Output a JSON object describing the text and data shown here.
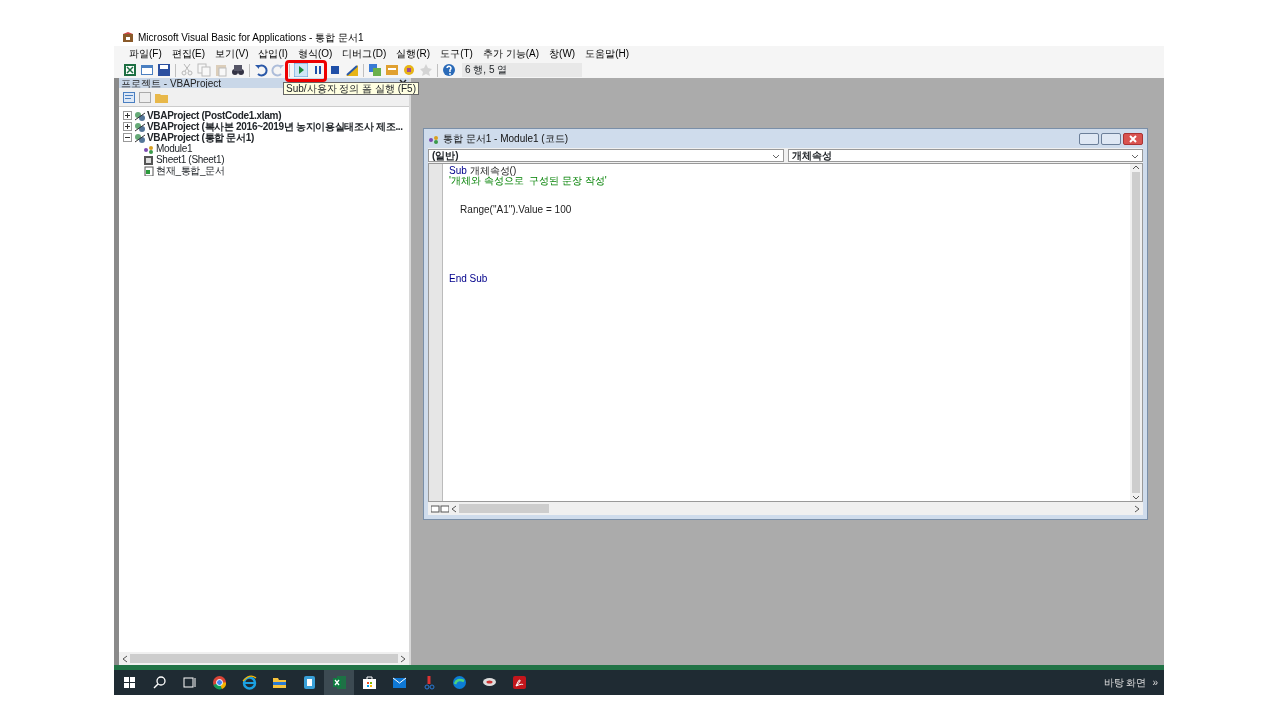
{
  "window": {
    "title": "Microsoft Visual Basic for Applications - 통합 문서1"
  },
  "menu": [
    "파일(F)",
    "편집(E)",
    "보기(V)",
    "삽입(I)",
    "형식(O)",
    "디버그(D)",
    "실행(R)",
    "도구(T)",
    "추가 기능(A)",
    "창(W)",
    "도움말(H)"
  ],
  "toolbar": {
    "items": [
      {
        "kind": "spreadsheet",
        "disabled": false
      },
      {
        "kind": "form",
        "disabled": false
      },
      {
        "kind": "save",
        "disabled": false
      },
      {
        "kind": "separator"
      },
      {
        "kind": "cut",
        "disabled": true
      },
      {
        "kind": "copy",
        "disabled": true
      },
      {
        "kind": "paste",
        "disabled": true
      },
      {
        "kind": "find",
        "disabled": false
      },
      {
        "kind": "separator"
      },
      {
        "kind": "undo",
        "disabled": false
      },
      {
        "kind": "redo",
        "disabled": true
      },
      {
        "kind": "separator"
      },
      {
        "kind": "run",
        "disabled": false,
        "highlighted": true
      },
      {
        "kind": "pause",
        "disabled": false
      },
      {
        "kind": "stop",
        "disabled": false
      },
      {
        "kind": "design",
        "disabled": false
      },
      {
        "kind": "separator"
      },
      {
        "kind": "explorer",
        "disabled": false
      },
      {
        "kind": "properties",
        "disabled": false
      },
      {
        "kind": "browser",
        "disabled": false
      },
      {
        "kind": "toolbox",
        "disabled": true
      },
      {
        "kind": "separator"
      },
      {
        "kind": "help",
        "disabled": false
      }
    ],
    "position": "6 행, 5 열"
  },
  "tooltip": "Sub/사용자 정의 폼 실행 (F5)",
  "project_panel": {
    "title": "프로젝트 - VBAProject",
    "tree": [
      {
        "label": "VBAProject (PostCode1.xlam)",
        "kind": "project",
        "expanded": false
      },
      {
        "label": "VBAProject (복사본 2016~2019년 농지이용실태조사 제조...",
        "kind": "project",
        "expanded": false
      },
      {
        "label": "VBAProject (통합 문서1)",
        "kind": "project",
        "expanded": true,
        "children": [
          {
            "label": "Module1",
            "kind": "module"
          },
          {
            "label": "Sheet1 (Sheet1)",
            "kind": "sheet"
          },
          {
            "label": "현재_통합_문서",
            "kind": "workbook"
          }
        ]
      }
    ]
  },
  "code_window": {
    "title": "통합 문서1 - Module1 (코드)",
    "object_combo": "(일반)",
    "procedure_combo": "개체속성",
    "lines": [
      {
        "kind": "code",
        "segments": [
          {
            "text": "Sub",
            "kind": "keyword"
          },
          {
            "text": " 개체속성()",
            "kind": "plain"
          }
        ]
      },
      {
        "kind": "code",
        "segments": [
          {
            "text": "'개체와 속성으로  구성된 문장 작성'",
            "kind": "comment"
          }
        ]
      },
      {
        "kind": "blank"
      },
      {
        "kind": "blank"
      },
      {
        "kind": "code",
        "segments": [
          {
            "text": "    Range(\"A1\").Value = 100",
            "kind": "plain"
          }
        ]
      },
      {
        "kind": "blank"
      },
      {
        "kind": "blank"
      },
      {
        "kind": "blank"
      },
      {
        "kind": "blank"
      },
      {
        "kind": "blank"
      },
      {
        "kind": "blank"
      },
      {
        "kind": "code",
        "segments": [
          {
            "text": "End Sub",
            "kind": "keyword"
          }
        ]
      }
    ]
  },
  "taskbar": {
    "apps": [
      {
        "kind": "start",
        "active": false
      },
      {
        "kind": "search",
        "active": false
      },
      {
        "kind": "taskview",
        "active": false
      },
      {
        "kind": "round-browser",
        "active": false
      },
      {
        "kind": "e-browser",
        "active": false
      },
      {
        "kind": "folder",
        "active": false
      },
      {
        "kind": "blue-app",
        "active": false
      },
      {
        "kind": "spreadsheet",
        "active": true
      },
      {
        "kind": "store",
        "active": false
      },
      {
        "kind": "mail",
        "active": false
      },
      {
        "kind": "red-app",
        "active": false
      },
      {
        "kind": "wave-browser",
        "active": false
      },
      {
        "kind": "disc",
        "active": false
      },
      {
        "kind": "pdf",
        "active": false
      }
    ],
    "desktop_label": "바탕 화면",
    "overflow": "»"
  }
}
